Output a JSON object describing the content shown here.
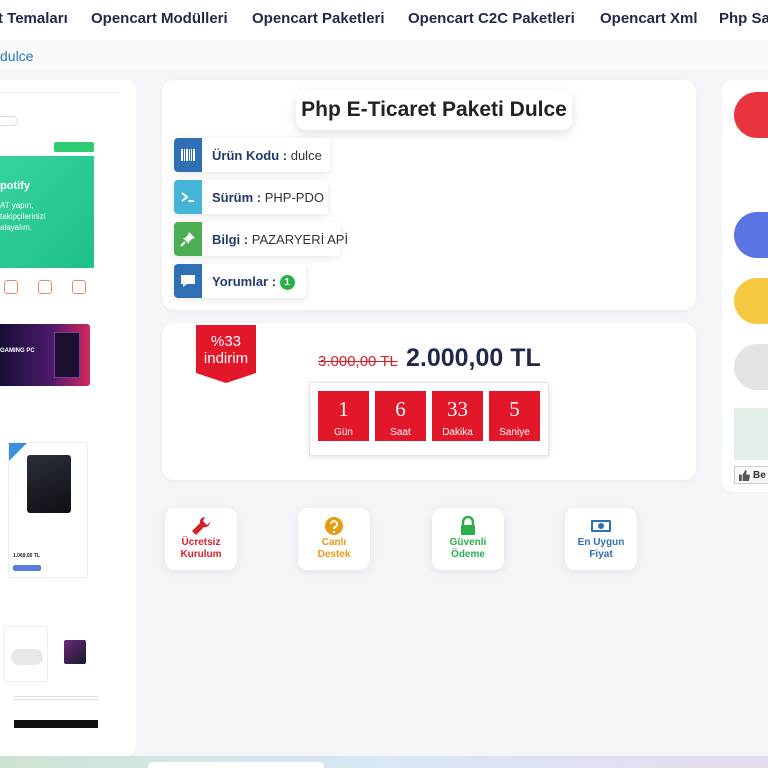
{
  "nav": {
    "items": [
      "t Temaları",
      "Opencart Modülleri",
      "Opencart Paketleri",
      "Opencart C2C Paketleri",
      "Opencart Xml",
      "Php Sa"
    ]
  },
  "breadcrumb": "dulce",
  "preview": {
    "banner_title": "potify",
    "banner_lines": [
      "AT yapın,",
      "takipçilerinizi",
      "alayalım."
    ],
    "gaming_label": "GAMING PC",
    "card_price": "1.069,00 TL"
  },
  "product": {
    "title": "Php E-Ticaret Paketi Dulce",
    "rows": [
      {
        "label": "Ürün Kodu :",
        "value": "dulce",
        "icon": "barcode-icon",
        "color": "#2f6fb3"
      },
      {
        "label": "Sürüm :",
        "value": "PHP-PDO",
        "icon": "terminal-icon",
        "color": "#45b4d9"
      },
      {
        "label": "Bilgi :",
        "value": "PAZARYERİ APİ",
        "icon": "pin-icon",
        "color": "#4cae52"
      },
      {
        "label": "Yorumlar :",
        "value": "1",
        "icon": "comment-icon",
        "color": "#2f6fb3"
      }
    ]
  },
  "price": {
    "discount_line1": "%33",
    "discount_line2": "indirim",
    "old": "3.000,00 TL",
    "new": "2.000,00 TL"
  },
  "countdown": [
    {
      "value": "1",
      "unit": "Gün"
    },
    {
      "value": "6",
      "unit": "Saat"
    },
    {
      "value": "33",
      "unit": "Dakika"
    },
    {
      "value": "5",
      "unit": "Saniye"
    }
  ],
  "features": [
    {
      "line1": "Ücretsiz",
      "line2": "Kurulum",
      "icon": "wrench-icon",
      "color": "#d8202a"
    },
    {
      "line1": "Canlı",
      "line2": "Destek",
      "icon": "question-icon",
      "color": "#e89a12"
    },
    {
      "line1": "Güvenli",
      "line2": "Ödeme",
      "icon": "lock-icon",
      "color": "#2ab04a"
    },
    {
      "line1": "En Uygun",
      "line2": "Fiyat",
      "icon": "money-icon",
      "color": "#2f6fb3"
    }
  ],
  "right": {
    "like_label": "Be"
  },
  "colors": {
    "accent_red": "#e3172a",
    "navy": "#1f2a4a",
    "pill_red": "#e8343f",
    "pill_blue": "#5b74e3",
    "pill_yellow": "#f5c842",
    "pill_gray": "#e4e4e4"
  }
}
